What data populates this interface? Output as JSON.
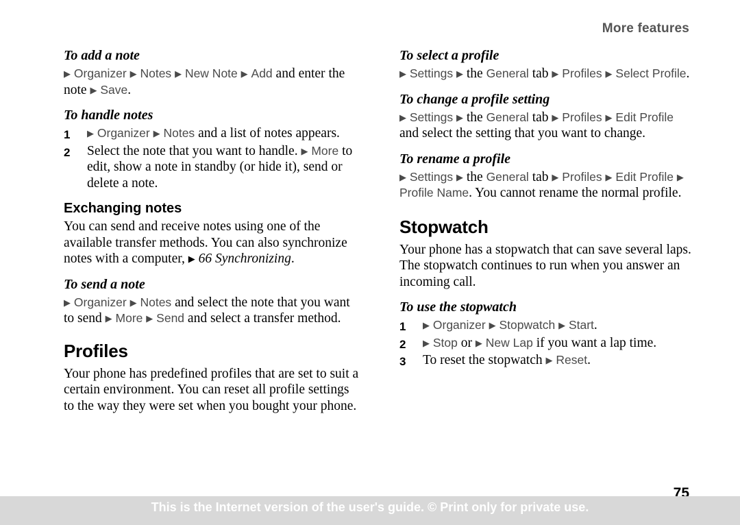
{
  "header": {
    "running_title": "More features"
  },
  "page_number": "75",
  "footer": {
    "notice": "This is the Internet version of the user's guide. © Print only for private use."
  },
  "glyphs": {
    "arrow": "▶"
  },
  "left_column": {
    "add_note": {
      "heading": "To add a note",
      "line1_a": "Organizer",
      "line1_b": "Notes",
      "line1_c": "New Note",
      "line1_d": "Add",
      "line1_tail": "and enter",
      "line2_lead": "the note",
      "line2_ui": "Save",
      "line2_tail": "."
    },
    "handle_notes": {
      "heading": "To handle notes",
      "items": [
        {
          "num": "1",
          "ui1": "Organizer",
          "ui2": "Notes",
          "tail": "and a list of notes appears."
        },
        {
          "num": "2",
          "lead": "Select the note that you want to handle.",
          "ui1": "More",
          "tail": "to edit, show a note in standby (or hide it), send or delete a note."
        }
      ]
    },
    "exchanging_notes": {
      "heading": "Exchanging notes",
      "body_a": "You can send and receive notes using one of the available transfer methods. You can also synchronize notes with a computer,",
      "ref": "66 Synchronizing",
      "body_b": "."
    },
    "send_note": {
      "heading": "To send a note",
      "ui1": "Organizer",
      "ui2": "Notes",
      "mid1": "and select the note that you want to send",
      "ui3": "More",
      "ui4": "Send",
      "mid2": "and select a transfer method."
    },
    "profiles": {
      "heading": "Profiles",
      "body": "Your phone has predefined profiles that are set to suit a certain environment. You can reset all profile settings to the way they were set when you bought your phone."
    }
  },
  "right_column": {
    "select_profile": {
      "heading": "To select a profile",
      "ui1": "Settings",
      "the": "the",
      "ui2": "General",
      "tab": "tab",
      "ui3": "Profiles",
      "ui4": "Select Profile",
      "tail": "."
    },
    "change_profile_setting": {
      "heading": "To change a profile setting",
      "ui1": "Settings",
      "the": "the",
      "ui2": "General",
      "tab": "tab",
      "ui3": "Profiles",
      "ui4": "Edit Profile",
      "tail": "and select the setting that you want to change."
    },
    "rename_profile": {
      "heading": "To rename a profile",
      "ui1": "Settings",
      "the": "the",
      "ui2": "General",
      "tab": "tab",
      "ui3": "Profiles",
      "ui4": "Edit Profile",
      "ui5": "Profile Name",
      "tail": ". You cannot rename the normal profile."
    },
    "stopwatch": {
      "heading": "Stopwatch",
      "body": "Your phone has a stopwatch that can save several laps. The stopwatch continues to run when you answer an incoming call."
    },
    "use_stopwatch": {
      "heading": "To use the stopwatch",
      "items": [
        {
          "num": "1",
          "ui1": "Organizer",
          "ui2": "Stopwatch",
          "ui3": "Start",
          "tail": "."
        },
        {
          "num": "2",
          "ui1": "Stop",
          "mid": "or",
          "ui2": "New Lap",
          "tail": "if you want a lap time."
        },
        {
          "num": "3",
          "lead": "To reset the stopwatch",
          "ui1": "Reset",
          "tail": "."
        }
      ]
    }
  }
}
